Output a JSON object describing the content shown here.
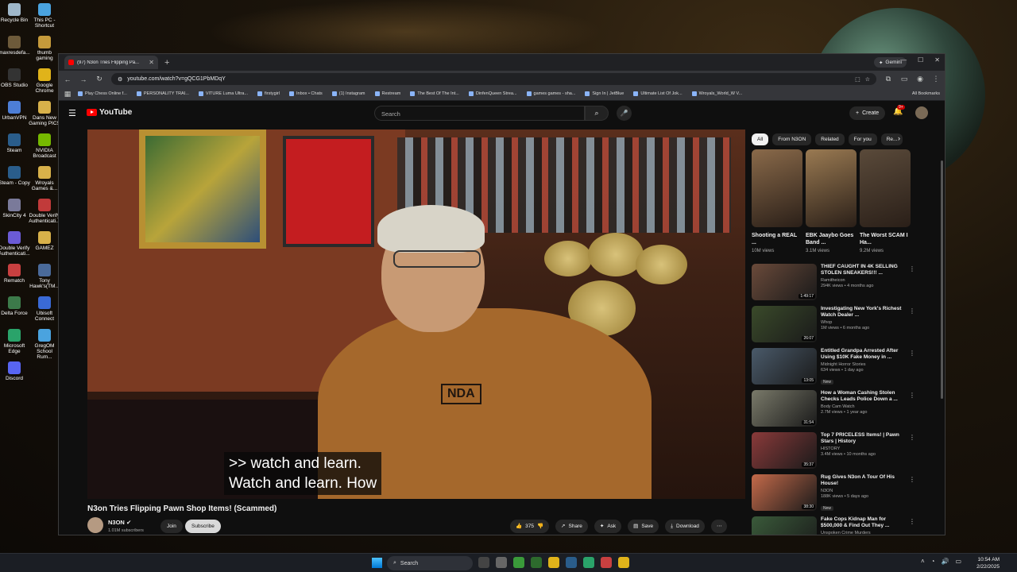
{
  "desktop": {
    "icons": [
      {
        "label": "Recycle Bin",
        "color": "#9fb7c9"
      },
      {
        "label": "This PC - Shortcut",
        "color": "#4aa3df"
      },
      {
        "label": "maxresdefa...",
        "color": "#6d5a3a"
      },
      {
        "label": "thumb gaming",
        "color": "#c59a3b"
      },
      {
        "label": "OBS Studio",
        "color": "#333333"
      },
      {
        "label": "Google Chrome",
        "color": "#e0b31a"
      },
      {
        "label": "UrbanVPN",
        "color": "#4d7ed6"
      },
      {
        "label": "Dans New Gaming PICS",
        "color": "#d8b14a"
      },
      {
        "label": "Steam",
        "color": "#2a5d8b"
      },
      {
        "label": "NVIDIA Broadcast",
        "color": "#76b900"
      },
      {
        "label": "Steam - Copy",
        "color": "#2a5d8b"
      },
      {
        "label": "Wroyals Games &...",
        "color": "#d8b14a"
      },
      {
        "label": "SkinCity 4",
        "color": "#7a7a9a"
      },
      {
        "label": "Double Verify Authenticati...",
        "color": "#c13a3a"
      },
      {
        "label": "Double Verify Authenticati...",
        "color": "#6b5bd6"
      },
      {
        "label": "GAMEZ",
        "color": "#d8b14a"
      },
      {
        "label": "Rematch",
        "color": "#c84040"
      },
      {
        "label": "Tony Hawk's(TM...",
        "color": "#4a6a9a"
      },
      {
        "label": "Delta Force",
        "color": "#3c7a4a"
      },
      {
        "label": "Ubisoft Connect",
        "color": "#3a6ad6"
      },
      {
        "label": "Microsoft Edge",
        "color": "#2aa36a"
      },
      {
        "label": "GregOM School Rum...",
        "color": "#4aa3df"
      },
      {
        "label": "Discord",
        "color": "#5865f2"
      }
    ]
  },
  "browser": {
    "tab_title": "(97) N3on Tries Flipping Pa...",
    "gemini_label": "Gemini",
    "url": "youtube.com/watch?v=gQCG1PbMDqY",
    "bookmarks": [
      "Play Chess Online f...",
      "PERSONALITY TRAI...",
      "VITURE Luma Ultra...",
      "firstygirl",
      "Inbox • Chats",
      "(1) Instagram",
      "Restream",
      "The Best Of The Int...",
      "DinfenQueen Strea...",
      "games games - sha...",
      "Sign In | JetBlue",
      "Ultimate List Of Jok...",
      "Wroyals_World_W V..."
    ],
    "all_bookmarks": "All Bookmarks"
  },
  "youtube": {
    "logo_text": "YouTube",
    "search_placeholder": "Search",
    "create_label": "Create",
    "notif_count": "9+",
    "caption": ">> watch and learn.\nWatch and learn. How",
    "video_title": "N3on Tries Flipping Pawn Shop Items! (Scammed)",
    "channel_name": "N3ON",
    "subscribers": "1.01M subscribers",
    "join_label": "Join",
    "subscribe_label": "Subscribe",
    "likes": "375",
    "share_label": "Share",
    "ask_label": "Ask",
    "save_label": "Save",
    "download_label": "Download",
    "chips": [
      "All",
      "From N3ON",
      "Related",
      "For you",
      "Re..."
    ],
    "shorts": [
      {
        "title": "Shooting a REAL ...",
        "views": "10M views",
        "color": "#8a6a4a"
      },
      {
        "title": "EBK Jaaybo Goes Band ...",
        "views": "3.1M views",
        "color": "#9a7a52"
      },
      {
        "title": "The Worst SCAM I Ha...",
        "views": "9.2M views",
        "color": "#5a4a3a"
      }
    ],
    "videos": [
      {
        "title": "THIEF CAUGHT IN 4K SELLING STOLEN SNEAKERS!!! ...",
        "channel": "Ramitheicon",
        "meta": "294K views • 4 months ago",
        "duration": "1:49:17",
        "new": "",
        "color": "#6a4a3a"
      },
      {
        "title": "Investigating New York's Richest Watch Dealer ...",
        "channel": "Whop",
        "meta": "1M views • 6 months ago",
        "duration": "26:07",
        "new": "",
        "color": "#3a4a2a"
      },
      {
        "title": "Entitled Grandpa Arrested After Using $10K Fake Money in ...",
        "channel": "Midnight Horror Stories",
        "meta": "634 views • 1 day ago",
        "duration": "13:05",
        "new": "New",
        "color": "#4a5a6a"
      },
      {
        "title": "How a Woman Cashing Stolen Checks Leads Police Down a ...",
        "channel": "Body Cam Watch",
        "meta": "2.7M views • 1 year ago",
        "duration": "31:54",
        "new": "",
        "color": "#7a7a6a"
      },
      {
        "title": "Top 7 PRICELESS Items! | Pawn Stars | History",
        "channel": "HISTORY",
        "meta": "3.4M views • 10 months ago",
        "duration": "35:37",
        "new": "",
        "color": "#8a3a3a"
      },
      {
        "title": "Rug Gives N3on A Tour Of His House!",
        "channel": "N3ON",
        "meta": "188K views • 5 days ago",
        "duration": "38:30",
        "new": "New",
        "color": "#c46a4a"
      },
      {
        "title": "Fake Cops Kidnap Man for $500,000 & Find Out They ...",
        "channel": "Unspoken Crime Murders",
        "meta": "",
        "duration": "",
        "new": "",
        "color": "#3a5a3a"
      }
    ]
  },
  "taskbar": {
    "search_label": "Search",
    "time": "10:54 AM",
    "date": "2/22/2025"
  }
}
